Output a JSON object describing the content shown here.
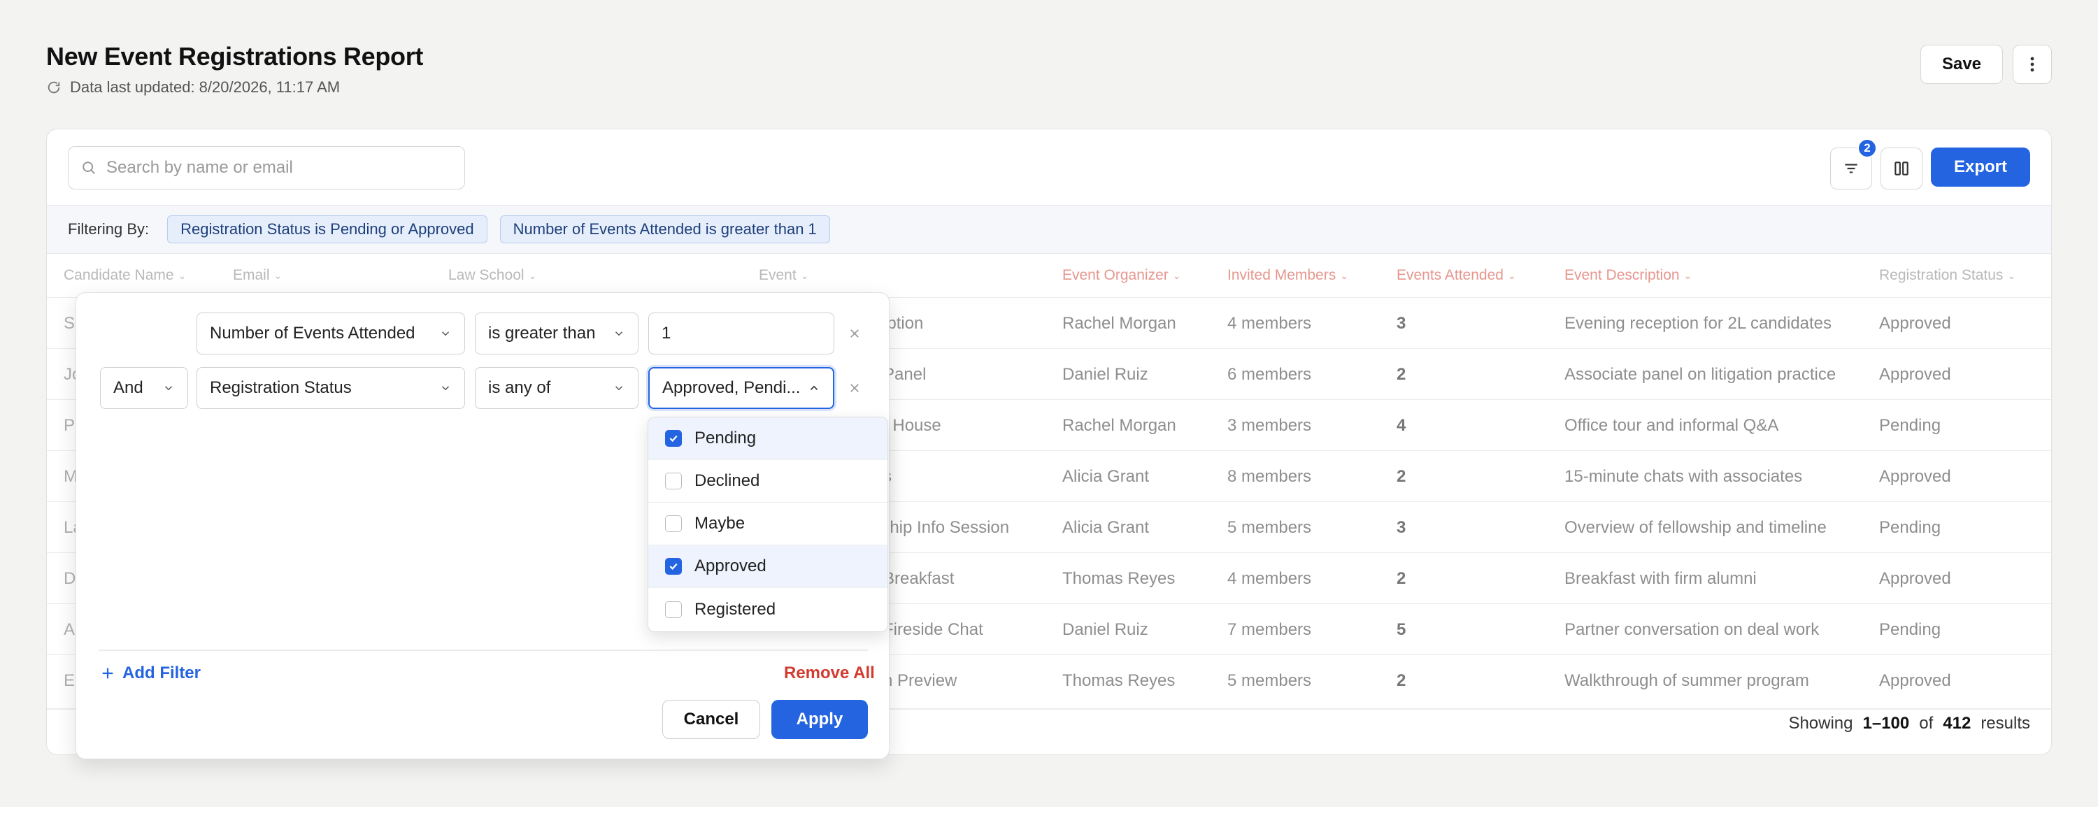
{
  "header": {
    "title": "New Event Registrations Report",
    "updated": "Data last updated: 8/20/2026, 11:17 AM",
    "save_label": "Save"
  },
  "toolbar": {
    "search_placeholder": "Search by name or email",
    "filter_count": "2",
    "export_label": "Export"
  },
  "filterbar": {
    "label": "Filtering By:",
    "chips": [
      "Registration Status is Pending or Approved",
      "Number of Events Attended is greater than 1"
    ]
  },
  "table": {
    "columns": [
      "Candidate Name",
      "Email",
      "Law School",
      "Event",
      "Event Organizer",
      "Invited Members",
      "Events Attended",
      "Event Description",
      "Registration Status"
    ],
    "rows": [
      {
        "first": "S",
        "event": "ception",
        "organizer": "Rachel Morgan",
        "invited": "4 members",
        "attended": "3",
        "description": "Evening reception for 2L candidates",
        "status": "Approved"
      },
      {
        "first": "Jo",
        "event": "e Panel",
        "organizer": "Daniel Ruiz",
        "invited": "6 members",
        "attended": "2",
        "description": "Associate panel on litigation practice",
        "status": "Approved"
      },
      {
        "first": "P",
        "event": "en House",
        "organizer": "Rachel Morgan",
        "invited": "3 members",
        "attended": "4",
        "description": "Office tour and informal Q&A",
        "status": "Pending"
      },
      {
        "first": "M",
        "event": "ats",
        "organizer": "Alicia Grant",
        "invited": "8 members",
        "attended": "2",
        "description": "15-minute chats with associates",
        "status": "Approved"
      },
      {
        "first": "La",
        "event": "wship Info Session",
        "organizer": "Alicia Grant",
        "invited": "5 members",
        "attended": "3",
        "description": "Overview of fellowship and timeline",
        "status": "Pending"
      },
      {
        "first": "D",
        "event": "g Breakfast",
        "organizer": "Thomas Reyes",
        "invited": "4 members",
        "attended": "2",
        "description": "Breakfast with firm alumni",
        "status": "Approved"
      },
      {
        "first": "A",
        "event": "e Fireside Chat",
        "organizer": "Daniel Ruiz",
        "invited": "7 members",
        "attended": "5",
        "description": "Partner conversation on deal work",
        "status": "Pending"
      },
      {
        "first": "E",
        "event": "am Preview",
        "organizer": "Thomas Reyes",
        "invited": "5 members",
        "attended": "2",
        "description": "Walkthrough of summer program",
        "status": "Approved"
      }
    ],
    "results": {
      "showing": "Showing",
      "range": "1–100",
      "of": "of",
      "total": "412",
      "suffix": "results"
    }
  },
  "filter_panel": {
    "row1": {
      "field": "Number of Events Attended",
      "operator": "is greater than",
      "value": "1"
    },
    "row2": {
      "conjunction": "And",
      "field": "Registration Status",
      "operator": "is any of",
      "value": "Approved, Pendi..."
    },
    "add_filter": "Add Filter",
    "remove_all": "Remove All",
    "cancel": "Cancel",
    "apply": "Apply"
  },
  "status_options": [
    {
      "label": "Pending",
      "checked": true
    },
    {
      "label": "Declined",
      "checked": false
    },
    {
      "label": "Maybe",
      "checked": false
    },
    {
      "label": "Approved",
      "checked": true
    },
    {
      "label": "Registered",
      "checked": false
    }
  ],
  "colors": {
    "accent": "#2464e0",
    "danger": "#d23b2f",
    "header_accent": "#e6968e"
  }
}
